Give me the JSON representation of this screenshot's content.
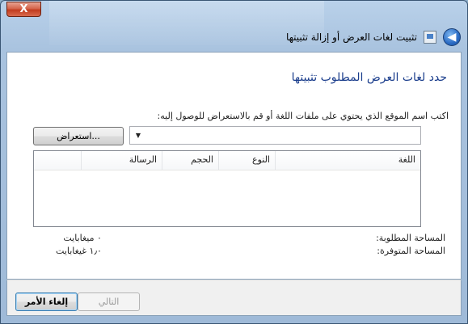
{
  "window": {
    "title": "تثبيت لغات العرض أو إزالة تثبيتها",
    "close_glyph": "X",
    "back_glyph": "◀"
  },
  "page": {
    "heading": "حدد لغات العرض المطلوب تثبيتها",
    "instruction": "اكتب اسم الموقع الذي يحتوي على ملفات اللغة أو قم بالاستعراض للوصول إليه:",
    "location_value": "",
    "browse_label": "استعراض...",
    "table": {
      "columns": [
        "اللغة",
        "النوع",
        "الحجم",
        "الرسالة"
      ],
      "rows": []
    },
    "space": {
      "required_label": "المساحة المطلوبة:",
      "required_value": "٠ ميغابايت",
      "available_label": "المساحة المتوفرة:",
      "available_value": "١٫٠ غيغابايت"
    }
  },
  "buttons": {
    "next": "التالي",
    "cancel": "إلغاء الأمر"
  }
}
